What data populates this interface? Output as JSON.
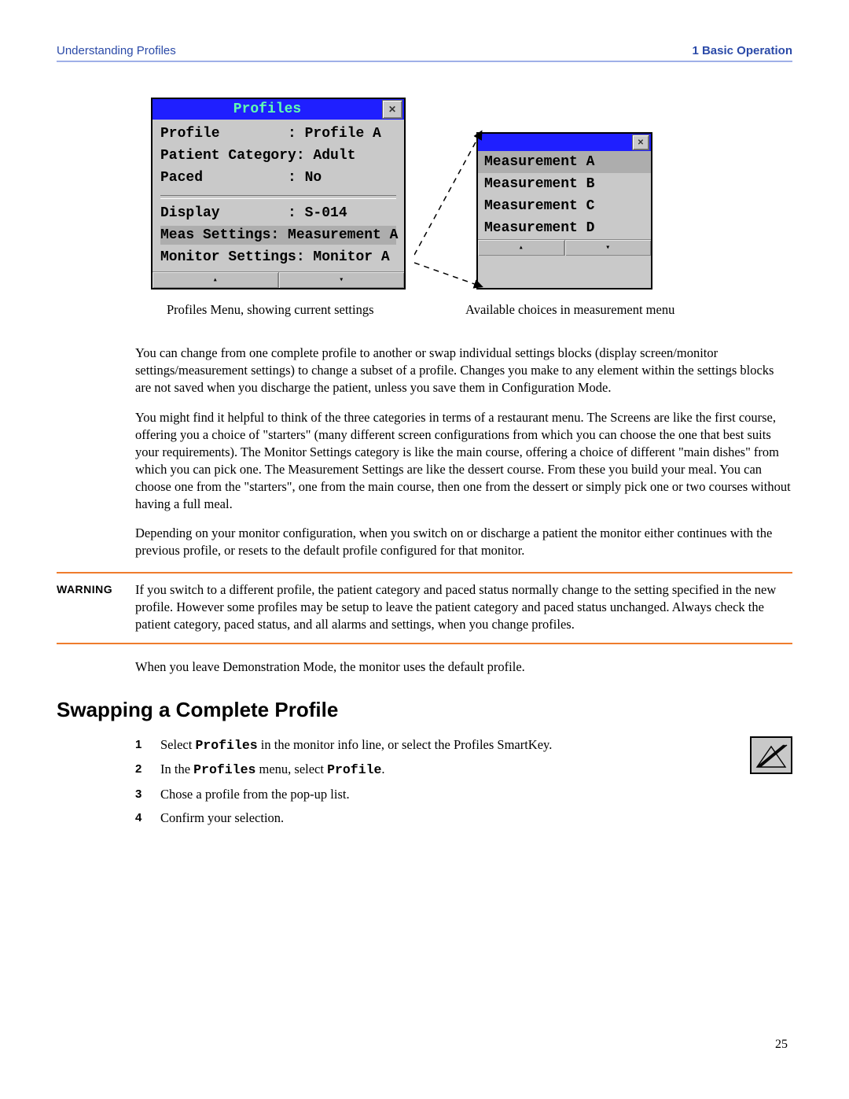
{
  "header": {
    "left": "Understanding Profiles",
    "right_prefix": "1",
    "right": "Basic Operation"
  },
  "profiles_window": {
    "title": "Profiles",
    "rows": [
      "Profile        : Profile A",
      "Patient Category: Adult",
      "Paced          : No",
      "Display        : S-014",
      "Meas Settings: Measurement A",
      "Monitor Settings: Monitor A"
    ]
  },
  "measurement_window": {
    "title": "",
    "items": [
      "Measurement A",
      "Measurement B",
      "Measurement C",
      "Measurement D"
    ]
  },
  "captions": {
    "c1": "Profiles Menu, showing current settings",
    "c2": "Available choices in measurement menu"
  },
  "paragraphs": {
    "p1": "You can change from one complete profile to another or swap individual settings blocks (display screen/monitor settings/measurement settings) to change a subset of a profile. Changes you make to any element within the settings blocks are not saved when you discharge the patient, unless you save them in Configuration Mode.",
    "p2": "You might find it helpful to think of the three categories in terms of a restaurant menu. The Screens are like the first course, offering you a choice of \"starters\" (many different screen configurations from which you can choose the one that best suits your requirements). The Monitor Settings category is like the main course, offering a choice of different \"main dishes\" from which you can pick one. The Measurement Settings are like the dessert course. From these you build your meal. You can choose one from the \"starters\", one from the main course, then one from the dessert or simply pick one or two courses without having a full meal.",
    "p3": "Depending on your monitor configuration, when you switch on or discharge a patient the monitor either continues with the previous profile, or resets to the default profile configured for that monitor."
  },
  "warning": {
    "label": "WARNING",
    "text": "If you switch to a different profile, the patient category and paced status normally change to the setting specified in the new profile. However some profiles may be setup to leave the patient category and paced status unchanged. Always check the patient category, paced status, and all alarms and settings, when you change profiles."
  },
  "afterwarning": "When you leave Demonstration Mode, the monitor uses the default profile.",
  "section_heading": "Swapping a Complete Profile",
  "steps": {
    "s1a": "Select ",
    "s1b": "Profiles",
    "s1c": " in the monitor info line, or select the Profiles SmartKey.",
    "s2a": "In the ",
    "s2b": "Profiles",
    "s2c": " menu, select ",
    "s2d": "Profile",
    "s2e": ".",
    "s3": "Chose a profile from the pop-up list.",
    "s4": "Confirm your selection."
  },
  "page_number": "25"
}
